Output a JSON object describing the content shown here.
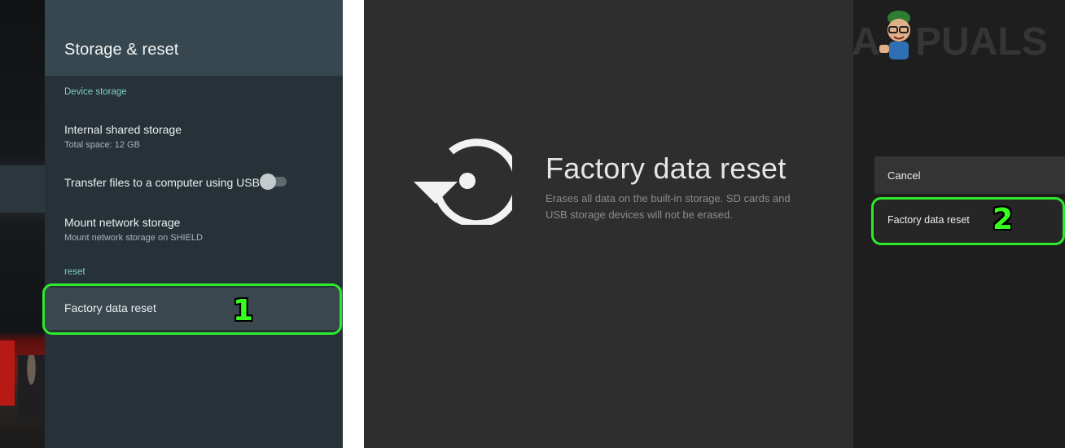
{
  "left_panel": {
    "header": {
      "title": "Storage & reset"
    },
    "sections": [
      {
        "label": "Device storage",
        "items": [
          {
            "title": "Internal shared storage",
            "subtitle": "Total space: 12 GB"
          },
          {
            "title": "Transfer files to a computer using USB",
            "toggle_on": false
          },
          {
            "title": "Mount network storage",
            "subtitle": "Mount network storage on SHIELD"
          }
        ]
      },
      {
        "label": "reset",
        "items": [
          {
            "title": "Factory data reset",
            "selected": true
          }
        ]
      }
    ],
    "step_marker": "1"
  },
  "right_panel": {
    "dialog": {
      "icon": "reset-icon",
      "title": "Factory data reset",
      "description": "Erases all data on the built-in storage. SD cards and USB storage devices will not be erased."
    },
    "actions": [
      {
        "label": "Cancel"
      },
      {
        "label": "Factory data reset",
        "highlighted": true
      }
    ],
    "step_marker": "2"
  },
  "watermark": {
    "text": "APPUALS"
  },
  "colors": {
    "highlight": "#2eea2e",
    "step_number": "#39ff1f",
    "section_label": "#80cbc4",
    "settings_bg": "#263238",
    "settings_header_bg": "#37474f"
  }
}
